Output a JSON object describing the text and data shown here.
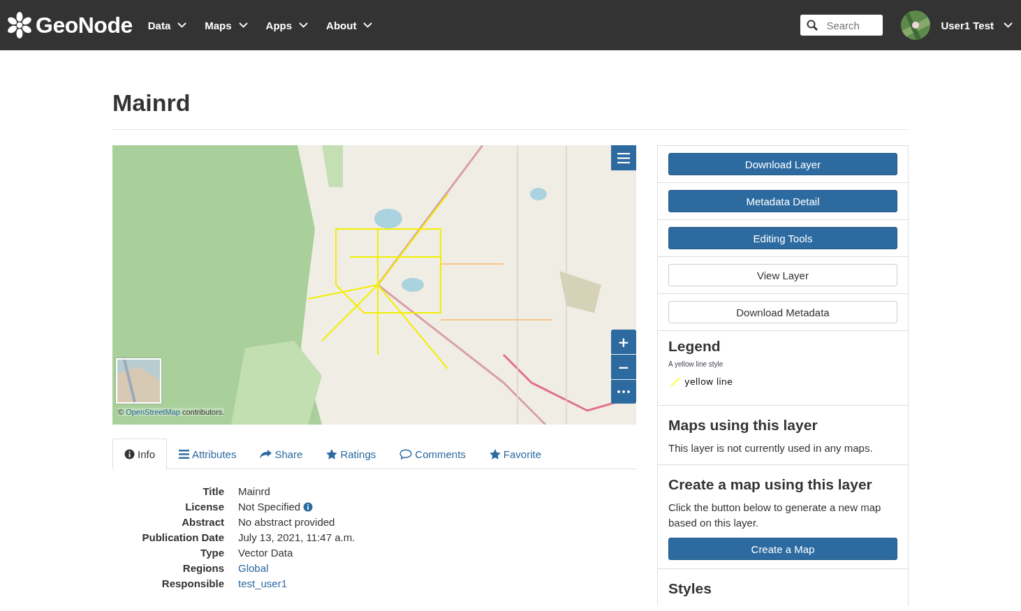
{
  "navbar": {
    "brand": "GeoNode",
    "menus": [
      {
        "label": "Data"
      },
      {
        "label": "Maps"
      },
      {
        "label": "Apps"
      },
      {
        "label": "About"
      }
    ],
    "search": {
      "placeholder": "Search"
    },
    "user": {
      "name": "User1 Test"
    }
  },
  "page": {
    "title": "Mainrd"
  },
  "map": {
    "attribution_prefix": "©",
    "attribution_link": "OpenStreetMap",
    "attribution_suffix": "contributors.",
    "zoom_in": "+",
    "zoom_out": "−",
    "more": "•••"
  },
  "tabs": [
    {
      "label": "Info",
      "kind": "info",
      "selected": true
    },
    {
      "label": "Attributes",
      "kind": "list",
      "selected": false
    },
    {
      "label": "Share",
      "kind": "share",
      "selected": false
    },
    {
      "label": "Ratings",
      "kind": "star",
      "selected": false
    },
    {
      "label": "Comments",
      "kind": "comment",
      "selected": false
    },
    {
      "label": "Favorite",
      "kind": "star",
      "selected": false
    }
  ],
  "info": [
    {
      "label": "Title",
      "value": "Mainrd",
      "kind": "text"
    },
    {
      "label": "License",
      "value": "Not Specified",
      "kind": "info"
    },
    {
      "label": "Abstract",
      "value": "No abstract provided",
      "kind": "text"
    },
    {
      "label": "Publication Date",
      "value": "July 13, 2021, 11:47 a.m.",
      "kind": "text"
    },
    {
      "label": "Type",
      "value": "Vector Data",
      "kind": "text"
    },
    {
      "label": "Regions",
      "value": "Global",
      "kind": "link"
    },
    {
      "label": "Responsible",
      "value": "test_user1",
      "kind": "link"
    }
  ],
  "actions": [
    {
      "label": "Download Layer",
      "kind": "primary"
    },
    {
      "label": "Metadata Detail",
      "kind": "primary"
    },
    {
      "label": "Editing Tools",
      "kind": "primary"
    },
    {
      "label": "View Layer",
      "kind": "default"
    },
    {
      "label": "Download Metadata",
      "kind": "default"
    }
  ],
  "legend": {
    "title": "Legend",
    "subtitle": "A yellow line style",
    "items": [
      {
        "label": "yellow line",
        "color": "#ffff00"
      }
    ]
  },
  "maps_section": {
    "title": "Maps using this layer",
    "text": "This layer is not currently used in any maps."
  },
  "create_section": {
    "title": "Create a map using this layer",
    "text": "Click the button below to generate a new map based on this layer.",
    "button": "Create a Map"
  },
  "styles_section": {
    "title": "Styles"
  }
}
